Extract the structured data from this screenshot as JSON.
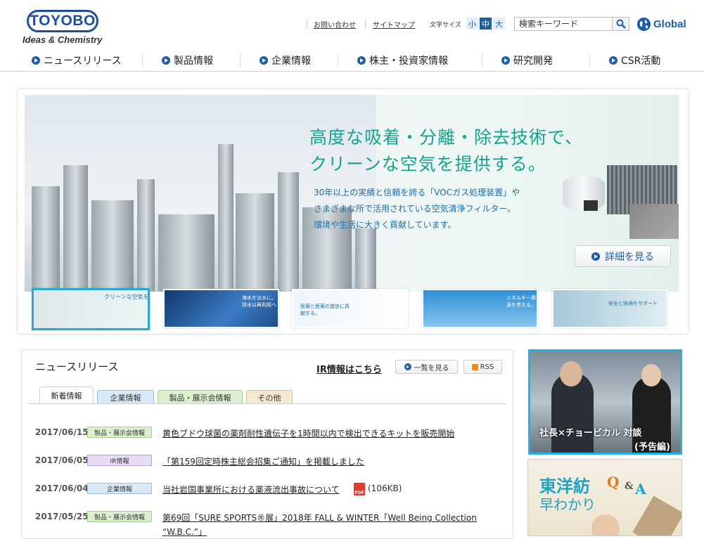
{
  "header": {
    "logo_text": "TOYOBO",
    "tagline": "Ideas & Chemistry",
    "util_links": [
      "お問い合わせ",
      "サイトマップ"
    ],
    "font_size_label": "文字サイズ",
    "font_sizes": [
      "小",
      "中",
      "大"
    ],
    "font_size_selected": "中",
    "search_placeholder": "検索キーワード",
    "global_label": "Global"
  },
  "nav": {
    "items": [
      "ニュースリリース",
      "製品情報",
      "企業情報",
      "株主・投資家情報",
      "研究開発",
      "CSR活動"
    ]
  },
  "hero": {
    "headline_1": "高度な吸着・分離・除去技術で、",
    "headline_2": "クリーンな空気を提供する。",
    "body_lines": [
      "30年以上の実績と信頼を誇る「VOCガス処理装置」や",
      "さまざまな所で活用されている空気清浄フィルター。",
      "環境や生活に大きく貢献しています。"
    ],
    "detail_button": "詳細を見る"
  },
  "thumbnails": [
    {
      "caption": "クリーンな空気を"
    },
    {
      "caption": "海水を淡水に。排水は再利用へ"
    },
    {
      "caption": "医療と医薬の進歩に貢献する。"
    },
    {
      "caption": "エネルギー資源を考える。"
    },
    {
      "caption": "安全と快適をサポート"
    }
  ],
  "news": {
    "title": "ニュースリリース",
    "ir_link": "IR情報はこちら",
    "list_button": "一覧を見る",
    "rss_button": "RSS",
    "tabs": [
      "新着情報",
      "企業情報",
      "製品・展示会情報",
      "その他"
    ],
    "active_tab": "新着情報",
    "items": [
      {
        "date": "2017/06/15",
        "category": "製品・展示会情報",
        "text": "黄色ブドウ球菌の薬剤耐性遺伝子を1時間以内で検出できるキットを販売開始"
      },
      {
        "date": "2017/06/05",
        "category": "IR情報",
        "text": "「第159回定時株主総会招集ご通知」を掲載しました"
      },
      {
        "date": "2017/06/04",
        "category": "企業情報",
        "text": "当社岩国事業所における薬液流出事故について",
        "file_size": "(106KB)",
        "file_type": "PDF"
      },
      {
        "date": "2017/05/25",
        "category": "製品・展示会情報",
        "text": "第69回「SURE SPORTS®展」2018年 FALL & WINTER「Well Being Collection"
      }
    ],
    "item_4_continued": "“W.B.C.”」"
  },
  "sidebar": {
    "banner1_line1": "社長×チョービカル 対談",
    "banner1_line2": "(予告編)",
    "banner2_title": "東洋紡",
    "banner2_subtitle": "早わかり",
    "banner2_q": "Q",
    "banner2_amp": "&",
    "banner2_a": "A"
  },
  "colors": {
    "brand_blue": "#1d5ea8",
    "hero_green": "#15a38f",
    "active_thumb": "#28a9d1"
  }
}
